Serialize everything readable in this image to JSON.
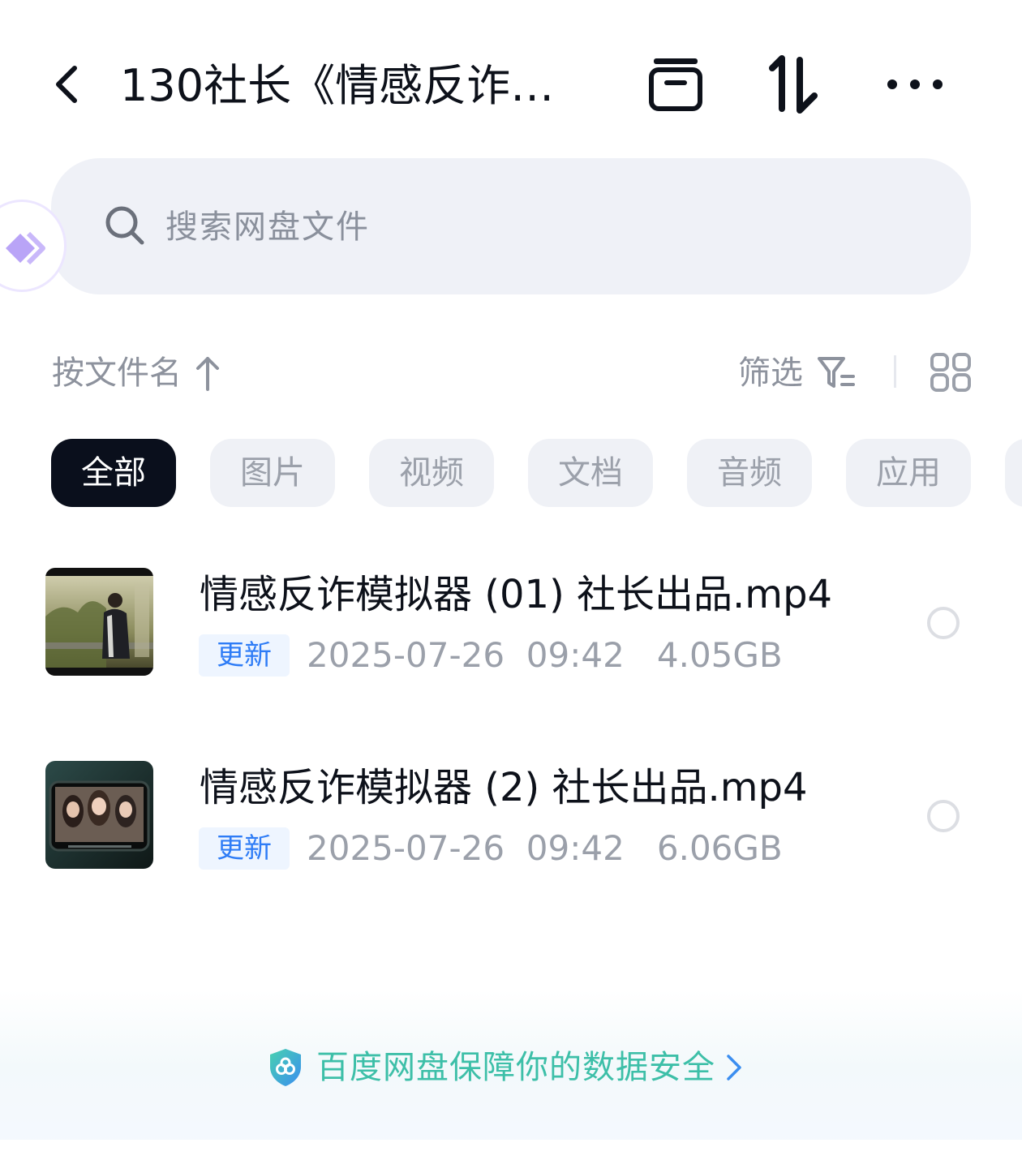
{
  "header": {
    "title": "130社长《情感反诈…",
    "back_icon": "chevron-left-icon",
    "archive_icon": "archive-box-icon",
    "sort_icon": "sort-toggle-icon",
    "more_icon": "more-dots-icon"
  },
  "search": {
    "placeholder": "搜索网盘文件",
    "icon": "search-icon"
  },
  "toolbar": {
    "sort_label": "按文件名",
    "sort_direction_icon": "arrow-up-icon",
    "filter_label": "筛选",
    "filter_icon": "filter-icon",
    "view_icon": "grid-view-icon"
  },
  "categories": [
    {
      "label": "全部",
      "active": true
    },
    {
      "label": "图片",
      "active": false
    },
    {
      "label": "视频",
      "active": false
    },
    {
      "label": "文档",
      "active": false
    },
    {
      "label": "音频",
      "active": false
    },
    {
      "label": "应用",
      "active": false
    }
  ],
  "files": [
    {
      "name": "情感反诈模拟器 (01) 社长出品.mp4",
      "badge": "更新",
      "meta": "2025-07-26  09:42   4.05GB",
      "type": "video"
    },
    {
      "name": "情感反诈模拟器 (2) 社长出品.mp4",
      "badge": "更新",
      "meta": "2025-07-26  09:42   6.06GB",
      "type": "video"
    }
  ],
  "footer": {
    "security_text": "百度网盘保障你的数据安全",
    "shield_icon": "shield-icon",
    "arrow_icon": "chevron-right-icon"
  },
  "colors": {
    "accent_blue": "#2e7cf6",
    "security_green": "#3dbfa8",
    "chip_active_bg": "#0a0f1c",
    "search_bg": "#eff1f7"
  }
}
